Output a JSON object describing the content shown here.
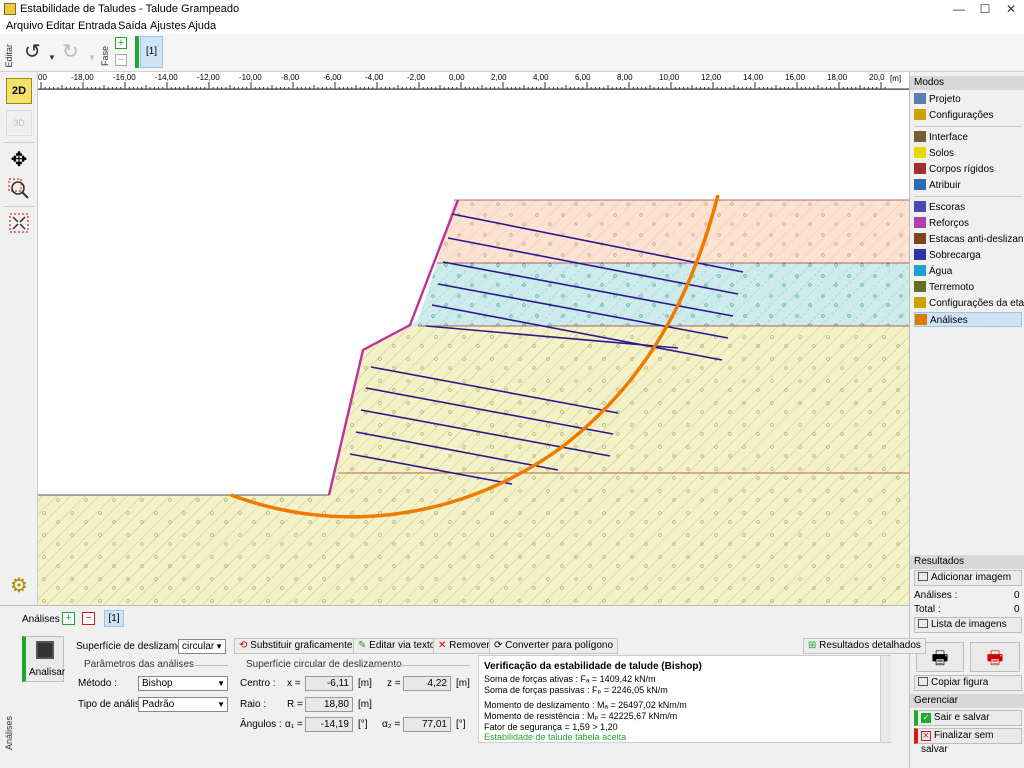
{
  "window": {
    "title": "Estabilidade de Taludes - Talude Grampeado",
    "controls": [
      "—",
      "☐",
      "✕"
    ]
  },
  "menu": [
    "Arquivo",
    "Editar",
    "Entrada",
    "Saída",
    "Ajustes",
    "Ajuda"
  ],
  "toolbar": {
    "edit_label": "Editar",
    "phase_label": "Fase",
    "phase_tab": "[1]"
  },
  "left_toolbar": {
    "btn_2d": "2D",
    "btn_3d": "3D"
  },
  "ruler": {
    "ticks": [
      "00",
      "-18,00",
      "-16,00",
      "-14,00",
      "-12,00",
      "-10,00",
      "-8,00",
      "-6,00",
      "-4,00",
      "-2,00",
      "0,00",
      "2,00",
      "4,00",
      "6,00",
      "8,00",
      "10,00",
      "12,00",
      "14,00",
      "16,00",
      "18,00",
      "20,0"
    ],
    "unit": "[m]"
  },
  "right_panel": {
    "modes_title": "Modos",
    "modes": [
      {
        "label": "Projeto",
        "icon": "document-icon",
        "color": "#5b7fb5"
      },
      {
        "label": "Configurações",
        "icon": "gear-icon",
        "color": "#c9a400"
      }
    ],
    "modes2": [
      {
        "label": "Interface",
        "icon": "interface-icon",
        "color": "#7a5c3a"
      },
      {
        "label": "Solos",
        "icon": "soil-icon",
        "color": "#e8d800"
      },
      {
        "label": "Corpos rígidos",
        "icon": "rigid-body-icon",
        "color": "#a03030"
      },
      {
        "label": "Atribuir",
        "icon": "assign-icon",
        "color": "#2e6bb0"
      }
    ],
    "modes3": [
      {
        "label": "Escoras",
        "icon": "anchor-icon",
        "color": "#4a4ab0"
      },
      {
        "label": "Reforços",
        "icon": "reinforcement-icon",
        "color": "#b040b0"
      },
      {
        "label": "Estacas anti-deslizantes",
        "icon": "pile-icon",
        "color": "#804020"
      },
      {
        "label": "Sobrecarga",
        "icon": "surcharge-icon",
        "color": "#3030a0"
      },
      {
        "label": "Água",
        "icon": "water-icon",
        "color": "#20a0d0"
      },
      {
        "label": "Terremoto",
        "icon": "earthquake-icon",
        "color": "#607020"
      },
      {
        "label": "Configurações da etapa",
        "icon": "stage-settings-icon",
        "color": "#c9a400"
      },
      {
        "label": "Análises",
        "icon": "analysis-icon",
        "color": "#e07a00"
      }
    ],
    "results_title": "Resultados",
    "add_image": "Adicionar imagem",
    "analyses_label": "Análises :",
    "analyses_count": "0",
    "total_label": "Total :",
    "total_count": "0",
    "image_list": "Lista de imagens",
    "copy_figure": "Copiar figura",
    "manage_title": "Gerenciar",
    "exit_save": "Sair e salvar",
    "finish_nosave": "Finalizar sem salvar"
  },
  "bottom": {
    "side_label": "Análises",
    "analyses_label": "Análises :",
    "analysis_tab": "[1]",
    "analyze_btn": "Analisar",
    "slip_surface_label": "Superfície de deslizamento :",
    "slip_surface_value": "circular",
    "btn_graphic": "Substituir graficamente",
    "btn_text": "Editar via texto",
    "btn_remove": "Remover",
    "btn_polygon": "Converter para polígono",
    "btn_detailed": "Resultados detalhados",
    "params_title": "Parâmetros das análises",
    "method_label": "Método :",
    "method_value": "Bishop",
    "type_label": "Tipo de análise :",
    "type_value": "Padrão",
    "circle_title": "Superfície circular de deslizamento",
    "center_label": "Centro :",
    "x_label": "x =",
    "x_value": "-6,11",
    "z_label": "z =",
    "z_value": "4,22",
    "unit_m": "[m]",
    "radius_label": "Raio :",
    "r_label": "R =",
    "r_value": "18,80",
    "angles_label": "Ângulos :",
    "a1_label": "α₁ =",
    "a1_value": "-14,19",
    "a2_label": "α₂ =",
    "a2_value": "77,01",
    "unit_deg": "[°]"
  },
  "results": {
    "title": "Verificação da estabilidade de talude (Bishop)",
    "line1": "Soma de forças ativas :        Fₐ =    1409,42  kN/m",
    "line2": "Soma de forças passivas :     Fₚ =    2246,05  kN/m",
    "line3": "Momento de deslizamento : Mₐ =  26497,02  kNm/m",
    "line4": "Momento de resistência :    Mₚ =  42225,67  kNm/m",
    "line5": "Fator de segurança = 1,59 > 1,20",
    "line6": "Estabilidade de talude tabela aceita"
  }
}
